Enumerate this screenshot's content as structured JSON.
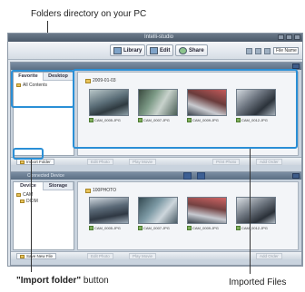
{
  "captions": {
    "folders": "Folders directory on your PC",
    "import_bold": "\"Import folder\"",
    "import_rest": " button",
    "files": "Imported Files"
  },
  "app": {
    "title": "Intelli-studio",
    "toolbar": {
      "library": "Library",
      "edit": "Edit",
      "share": "Share",
      "sort": "File Name"
    },
    "top_pane": {
      "tabs": [
        "Favorite",
        "Desktop"
      ],
      "tree": [
        "All Contents"
      ],
      "group_label": "2009-01-03",
      "files": [
        "CAM_0005.JPG",
        "CAM_0007.JPG",
        "CAM_0009.JPG",
        "CAM_0012.JPG"
      ],
      "bottom": {
        "import": "Import Folder",
        "b2": "Edit Photo",
        "b3": "Play Movie",
        "b4": "Print Photo",
        "b5": "Add Order"
      }
    },
    "bottom_pane": {
      "header": "Connected Device",
      "tabs": [
        "Device",
        "Storage"
      ],
      "tree": [
        "CAM",
        "DCIM"
      ],
      "group_label": "100PHOTO",
      "files": [
        "CAM_0005.JPG",
        "CAM_0007.JPG",
        "CAM_0009.JPG",
        "CAM_0012.JPG"
      ],
      "bottom": {
        "save": "Save New File",
        "b2": "Edit Photo",
        "b3": "Play Movie",
        "b4": "Add Order"
      }
    }
  }
}
